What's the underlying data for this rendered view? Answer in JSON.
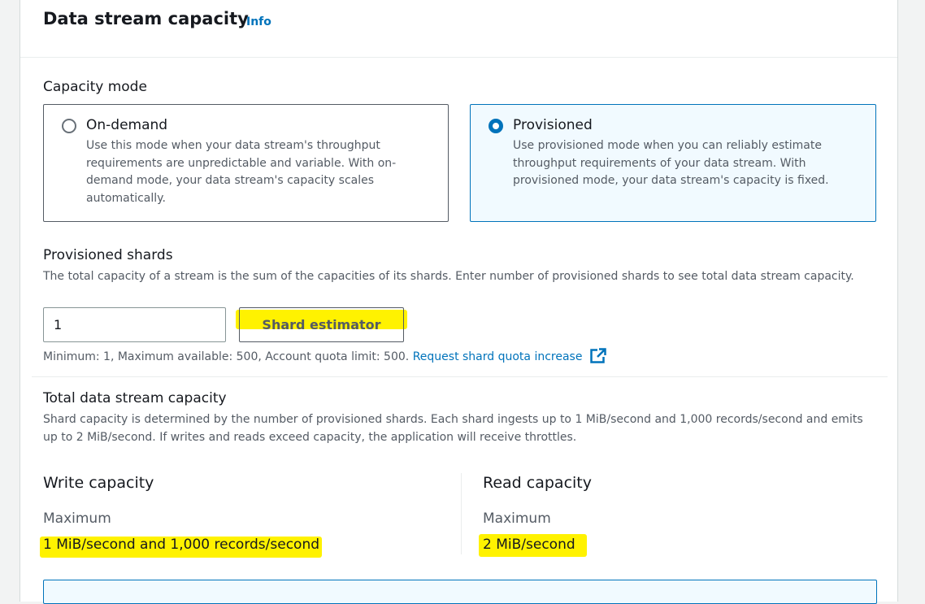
{
  "section": {
    "title": "Data stream capacity",
    "info_link": "Info"
  },
  "capacity_mode": {
    "label": "Capacity mode",
    "options": [
      {
        "label": "On-demand",
        "description": "Use this mode when your data stream's throughput requirements are unpredictable and variable. With on-demand mode, your data stream's capacity scales automatically.",
        "selected": false
      },
      {
        "label": "Provisioned",
        "description": "Use provisioned mode when you can reliably estimate throughput requirements of your data stream. With provisioned mode, your data stream's capacity is fixed.",
        "selected": true
      }
    ]
  },
  "provisioned_shards": {
    "label": "Provisioned shards",
    "description": "The total capacity of a stream is the sum of the capacities of its shards. Enter number of provisioned shards to see total data stream capacity.",
    "value": "1",
    "estimator_button": "Shard estimator",
    "constraint_text": "Minimum: 1, Maximum available: 500, Account quota limit: 500.",
    "quota_link": "Request shard quota increase"
  },
  "total_capacity": {
    "label": "Total data stream capacity",
    "description": "Shard capacity is determined by the number of provisioned shards. Each shard ingests up to 1 MiB/second and 1,000 records/second and emits up to 2 MiB/second. If writes and reads exceed capacity, the application will receive throttles.",
    "write": {
      "title": "Write capacity",
      "key": "Maximum",
      "value": "1 MiB/second and 1,000 records/second"
    },
    "read": {
      "title": "Read capacity",
      "key": "Maximum",
      "value": "2 MiB/second"
    }
  },
  "colors": {
    "accent": "#0073bb",
    "highlight": "#fff200",
    "selected_tile_bg": "#f1faff"
  },
  "icons": {
    "external_link": "external-link-icon"
  }
}
